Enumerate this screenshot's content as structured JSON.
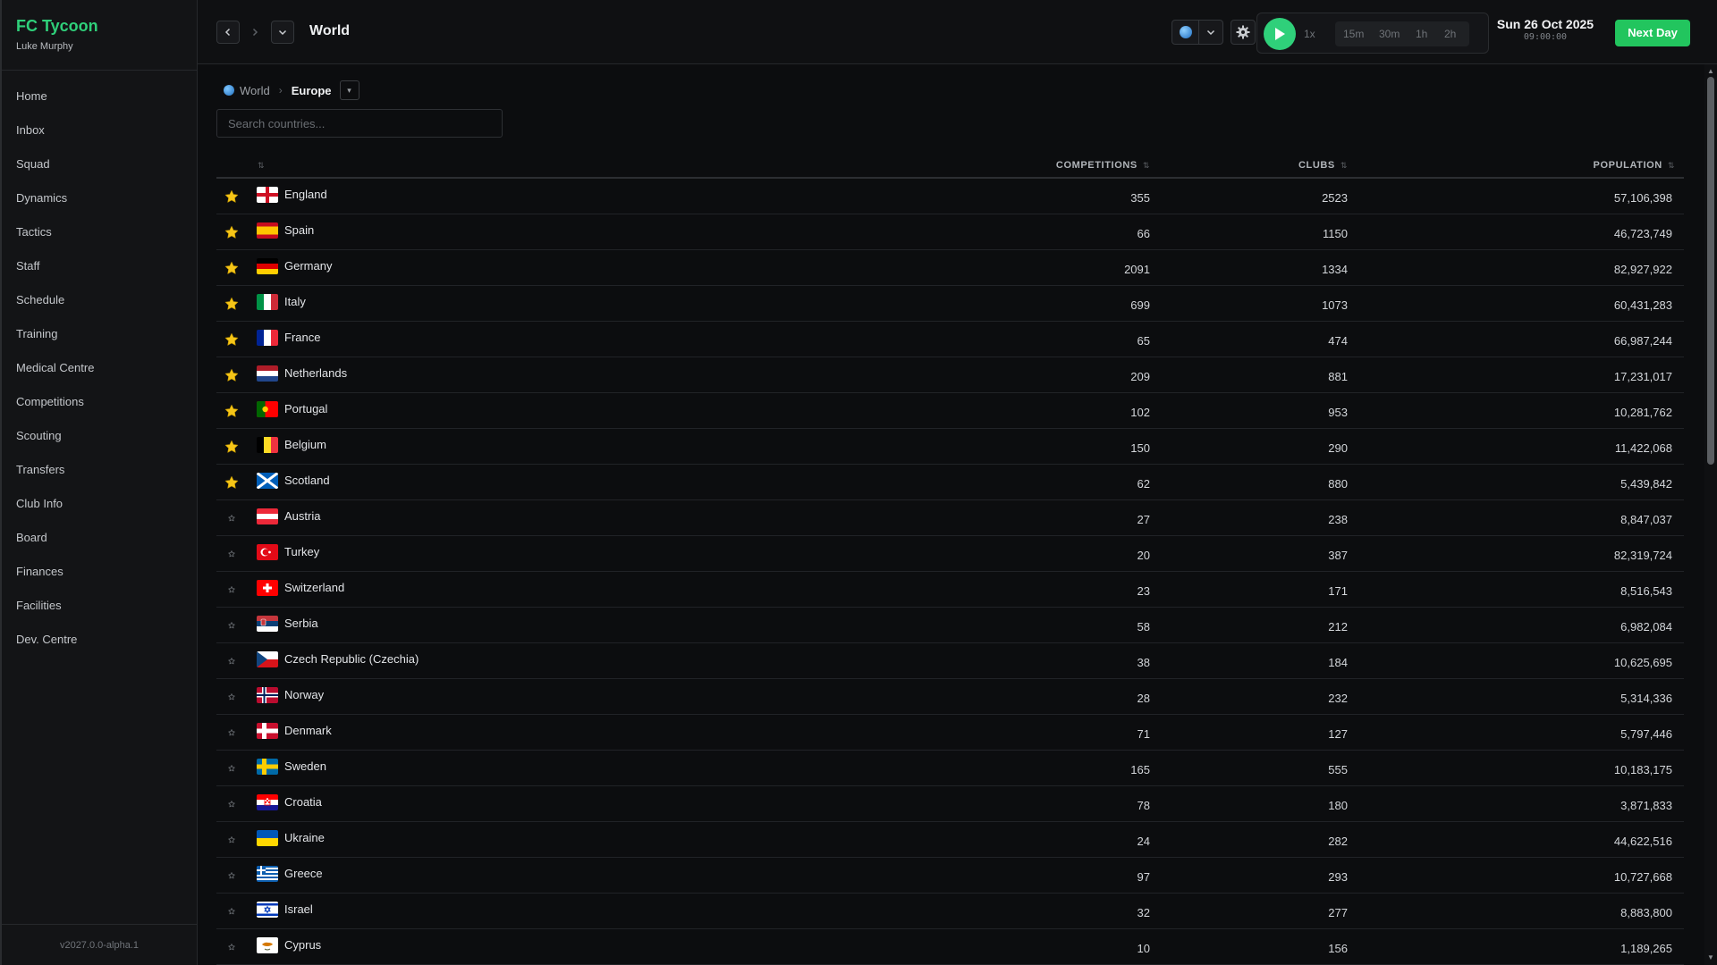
{
  "app": {
    "title": "FC Tycoon",
    "user": "Luke Murphy",
    "version": "v2027.0.0-alpha.1"
  },
  "sidebar": {
    "items": [
      {
        "label": "Home"
      },
      {
        "label": "Inbox"
      },
      {
        "label": "Squad"
      },
      {
        "label": "Dynamics"
      },
      {
        "label": "Tactics"
      },
      {
        "label": "Staff"
      },
      {
        "label": "Schedule"
      },
      {
        "label": "Training"
      },
      {
        "label": "Medical Centre"
      },
      {
        "label": "Competitions"
      },
      {
        "label": "Scouting"
      },
      {
        "label": "Transfers"
      },
      {
        "label": "Club Info"
      },
      {
        "label": "Board"
      },
      {
        "label": "Finances"
      },
      {
        "label": "Facilities"
      },
      {
        "label": "Dev. Centre"
      }
    ]
  },
  "topbar": {
    "title": "World",
    "speeds": {
      "s1": "1x",
      "s2": "15m",
      "s3": "30m",
      "s4": "1h",
      "s5": "2h"
    },
    "date": "Sun 26 Oct 2025",
    "time": "09:00:00",
    "next_day_label": "Next Day"
  },
  "breadcrumb": {
    "root": "World",
    "current": "Europe"
  },
  "search": {
    "placeholder": "Search countries..."
  },
  "table": {
    "headers": {
      "competitions": "COMPETITIONS",
      "clubs": "CLUBS",
      "population": "POPULATION"
    },
    "rows": [
      {
        "name": "England",
        "flag": "england",
        "favorite": true,
        "competitions": "355",
        "clubs": "2523",
        "population": "57,106,398"
      },
      {
        "name": "Spain",
        "flag": "spain",
        "favorite": true,
        "competitions": "66",
        "clubs": "1150",
        "population": "46,723,749"
      },
      {
        "name": "Germany",
        "flag": "germany",
        "favorite": true,
        "competitions": "2091",
        "clubs": "1334",
        "population": "82,927,922"
      },
      {
        "name": "Italy",
        "flag": "italy",
        "favorite": true,
        "competitions": "699",
        "clubs": "1073",
        "population": "60,431,283"
      },
      {
        "name": "France",
        "flag": "france",
        "favorite": true,
        "competitions": "65",
        "clubs": "474",
        "population": "66,987,244"
      },
      {
        "name": "Netherlands",
        "flag": "netherlands",
        "favorite": true,
        "competitions": "209",
        "clubs": "881",
        "population": "17,231,017"
      },
      {
        "name": "Portugal",
        "flag": "portugal",
        "favorite": true,
        "competitions": "102",
        "clubs": "953",
        "population": "10,281,762"
      },
      {
        "name": "Belgium",
        "flag": "belgium",
        "favorite": true,
        "competitions": "150",
        "clubs": "290",
        "population": "11,422,068"
      },
      {
        "name": "Scotland",
        "flag": "scotland",
        "favorite": true,
        "competitions": "62",
        "clubs": "880",
        "population": "5,439,842"
      },
      {
        "name": "Austria",
        "flag": "austria",
        "favorite": false,
        "competitions": "27",
        "clubs": "238",
        "population": "8,847,037"
      },
      {
        "name": "Turkey",
        "flag": "turkey",
        "favorite": false,
        "competitions": "20",
        "clubs": "387",
        "population": "82,319,724"
      },
      {
        "name": "Switzerland",
        "flag": "switzerland",
        "favorite": false,
        "competitions": "23",
        "clubs": "171",
        "population": "8,516,543"
      },
      {
        "name": "Serbia",
        "flag": "serbia",
        "favorite": false,
        "competitions": "58",
        "clubs": "212",
        "population": "6,982,084"
      },
      {
        "name": "Czech Republic (Czechia)",
        "flag": "czechia",
        "favorite": false,
        "competitions": "38",
        "clubs": "184",
        "population": "10,625,695"
      },
      {
        "name": "Norway",
        "flag": "norway",
        "favorite": false,
        "competitions": "28",
        "clubs": "232",
        "population": "5,314,336"
      },
      {
        "name": "Denmark",
        "flag": "denmark",
        "favorite": false,
        "competitions": "71",
        "clubs": "127",
        "population": "5,797,446"
      },
      {
        "name": "Sweden",
        "flag": "sweden",
        "favorite": false,
        "competitions": "165",
        "clubs": "555",
        "population": "10,183,175"
      },
      {
        "name": "Croatia",
        "flag": "croatia",
        "favorite": false,
        "competitions": "78",
        "clubs": "180",
        "population": "3,871,833"
      },
      {
        "name": "Ukraine",
        "flag": "ukraine",
        "favorite": false,
        "competitions": "24",
        "clubs": "282",
        "population": "44,622,516"
      },
      {
        "name": "Greece",
        "flag": "greece",
        "favorite": false,
        "competitions": "97",
        "clubs": "293",
        "population": "10,727,668"
      },
      {
        "name": "Israel",
        "flag": "israel",
        "favorite": false,
        "competitions": "32",
        "clubs": "277",
        "population": "8,883,800"
      },
      {
        "name": "Cyprus",
        "flag": "cyprus",
        "favorite": false,
        "competitions": "10",
        "clubs": "156",
        "population": "1,189,265"
      }
    ]
  },
  "colors": {
    "accent": "#2fd07a",
    "next_day": "#22c55e",
    "star": "#f5c518"
  }
}
